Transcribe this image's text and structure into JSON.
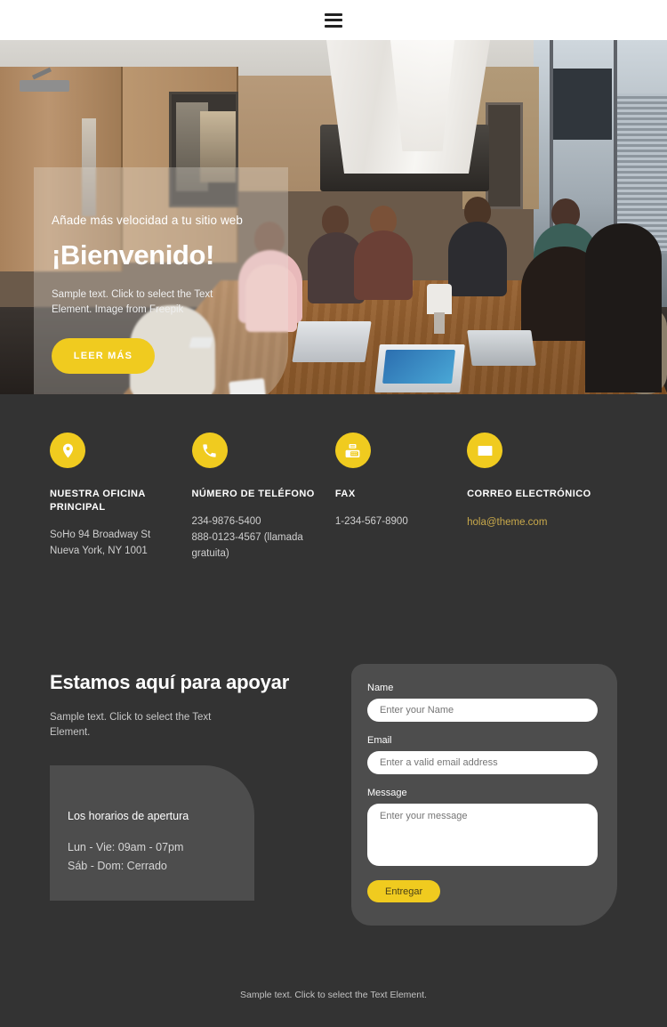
{
  "header": {
    "menu_icon": "hamburger-menu-icon"
  },
  "hero": {
    "kicker": "Añade más velocidad a tu sitio web",
    "title": "¡Bienvenido!",
    "subtitle": "Sample text. Click to select the Text Element. Image from Freepik",
    "cta_label": "LEER MÁS"
  },
  "contact": {
    "items": [
      {
        "icon": "location-pin-icon",
        "title": "NUESTRA OFICINA PRINCIPAL",
        "lines": "SoHo 94 Broadway St\nNueva York, NY 1001",
        "is_link": false
      },
      {
        "icon": "phone-icon",
        "title": "NÚMERO DE TELÉFONO",
        "lines": "234-9876-5400\n888-0123-4567 (llamada gratuita)",
        "is_link": false
      },
      {
        "icon": "fax-icon",
        "title": "FAX",
        "lines": "1-234-567-8900",
        "is_link": false
      },
      {
        "icon": "envelope-icon",
        "title": "CORREO ELECTRÓNICO",
        "lines": "hola@theme.com",
        "is_link": true
      }
    ]
  },
  "support": {
    "heading": "Estamos aquí para apoyar",
    "paragraph": "Sample text. Click to select the Text Element.",
    "hours": {
      "title": "Los horarios de apertura",
      "weekday": "Lun - Vie: 09am - 07pm",
      "weekend": "Sáb - Dom: Cerrado"
    }
  },
  "form": {
    "name_label": "Name",
    "name_placeholder": "Enter your Name",
    "email_label": "Email",
    "email_placeholder": "Enter a valid email address",
    "message_label": "Message",
    "message_placeholder": "Enter your message",
    "submit_label": "Entregar"
  },
  "footer": {
    "text": "Sample text. Click to select the Text Element."
  },
  "colors": {
    "accent": "#f0cb1f",
    "background_dark": "#333333",
    "panel": "#4d4d4d",
    "link": "#c9a94b",
    "header_bg": "#ffffff"
  }
}
